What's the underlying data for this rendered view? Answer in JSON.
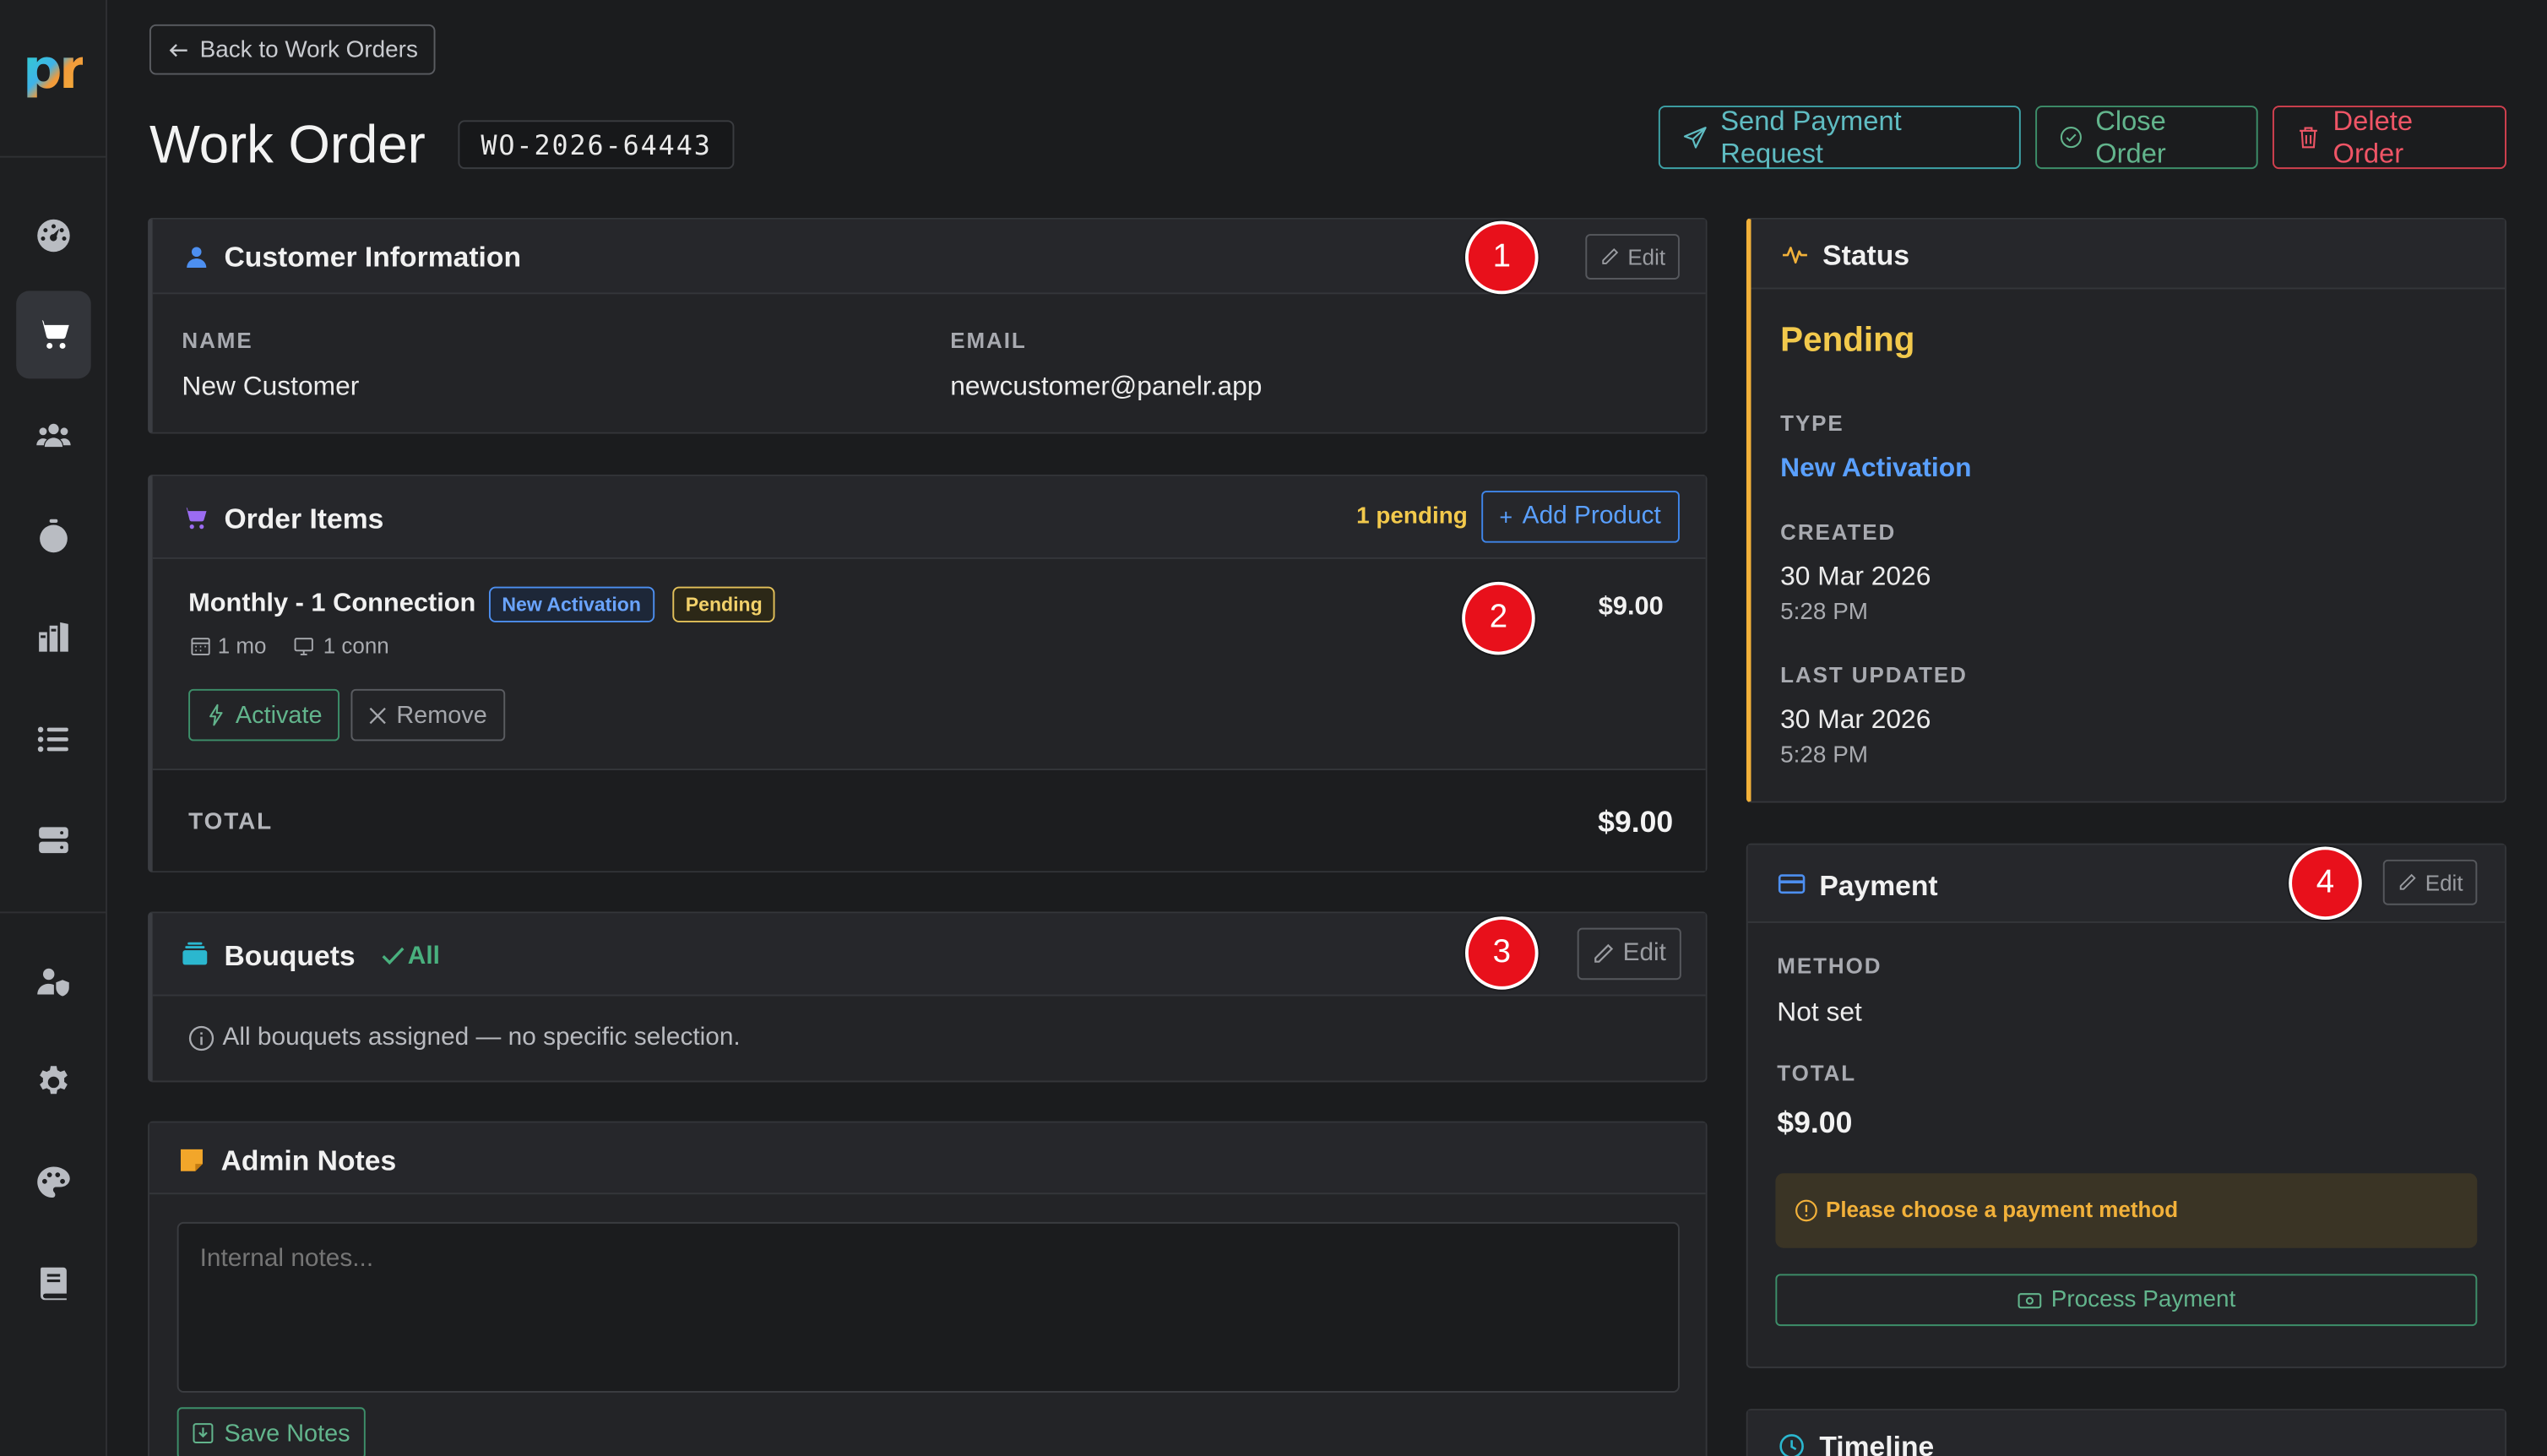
{
  "app": {
    "logo": "pr"
  },
  "header": {
    "back_label": "Back to Work Orders",
    "title": "Work Order",
    "order_id": "WO-2026-64443",
    "send_payment_label": "Send Payment Request",
    "close_order_label": "Close Order",
    "delete_order_label": "Delete Order"
  },
  "customer": {
    "title": "Customer Information",
    "edit_label": "Edit",
    "name_label": "NAME",
    "name_value": "New Customer",
    "email_label": "EMAIL",
    "email_value": "newcustomer@panelr.app"
  },
  "order_items": {
    "title": "Order Items",
    "pending_count": "1 pending",
    "add_product_label": "Add Product",
    "items": [
      {
        "name": "Monthly - 1 Connection",
        "type_badge": "New Activation",
        "status_badge": "Pending",
        "duration": "1 mo",
        "connections": "1 conn",
        "price": "$9.00",
        "activate_label": "Activate",
        "remove_label": "Remove"
      }
    ],
    "total_label": "TOTAL",
    "total_value": "$9.00"
  },
  "bouquets": {
    "title": "Bouquets",
    "all_label": "All",
    "edit_label": "Edit",
    "info_text": "All bouquets assigned — no specific selection."
  },
  "admin_notes": {
    "title": "Admin Notes",
    "placeholder": "Internal notes...",
    "save_label": "Save Notes"
  },
  "status": {
    "title": "Status",
    "value": "Pending",
    "type_label": "TYPE",
    "type_value": "New Activation",
    "created_label": "CREATED",
    "created_date": "30 Mar 2026",
    "created_time": "5:28 PM",
    "updated_label": "LAST UPDATED",
    "updated_date": "30 Mar 2026",
    "updated_time": "5:28 PM"
  },
  "payment": {
    "title": "Payment",
    "edit_label": "Edit",
    "method_label": "METHOD",
    "method_value": "Not set",
    "total_label": "TOTAL",
    "total_value": "$9.00",
    "warning_text": "Please choose a payment method",
    "process_label": "Process Payment"
  },
  "timeline": {
    "title": "Timeline"
  },
  "markers": [
    "1",
    "2",
    "3",
    "4"
  ],
  "colors": {
    "background": "#1b1c1e",
    "card": "#232427",
    "accent_yellow": "#f2c94c",
    "accent_blue": "#4d8ff0",
    "accent_teal": "#5fbcc2",
    "accent_green": "#62b48c",
    "accent_red": "#ef5566",
    "marker_red": "#e8101b"
  },
  "sidebar": {
    "items": [
      {
        "icon": "dashboard-gauge-icon"
      },
      {
        "icon": "cart-icon",
        "active": true
      },
      {
        "icon": "users-icon"
      },
      {
        "icon": "stopwatch-icon"
      },
      {
        "icon": "books-icon"
      },
      {
        "icon": "list-icon"
      },
      {
        "icon": "server-icon"
      },
      {
        "icon": "user-shield-icon"
      },
      {
        "icon": "gear-icon"
      },
      {
        "icon": "palette-icon"
      },
      {
        "icon": "book-icon"
      }
    ]
  }
}
